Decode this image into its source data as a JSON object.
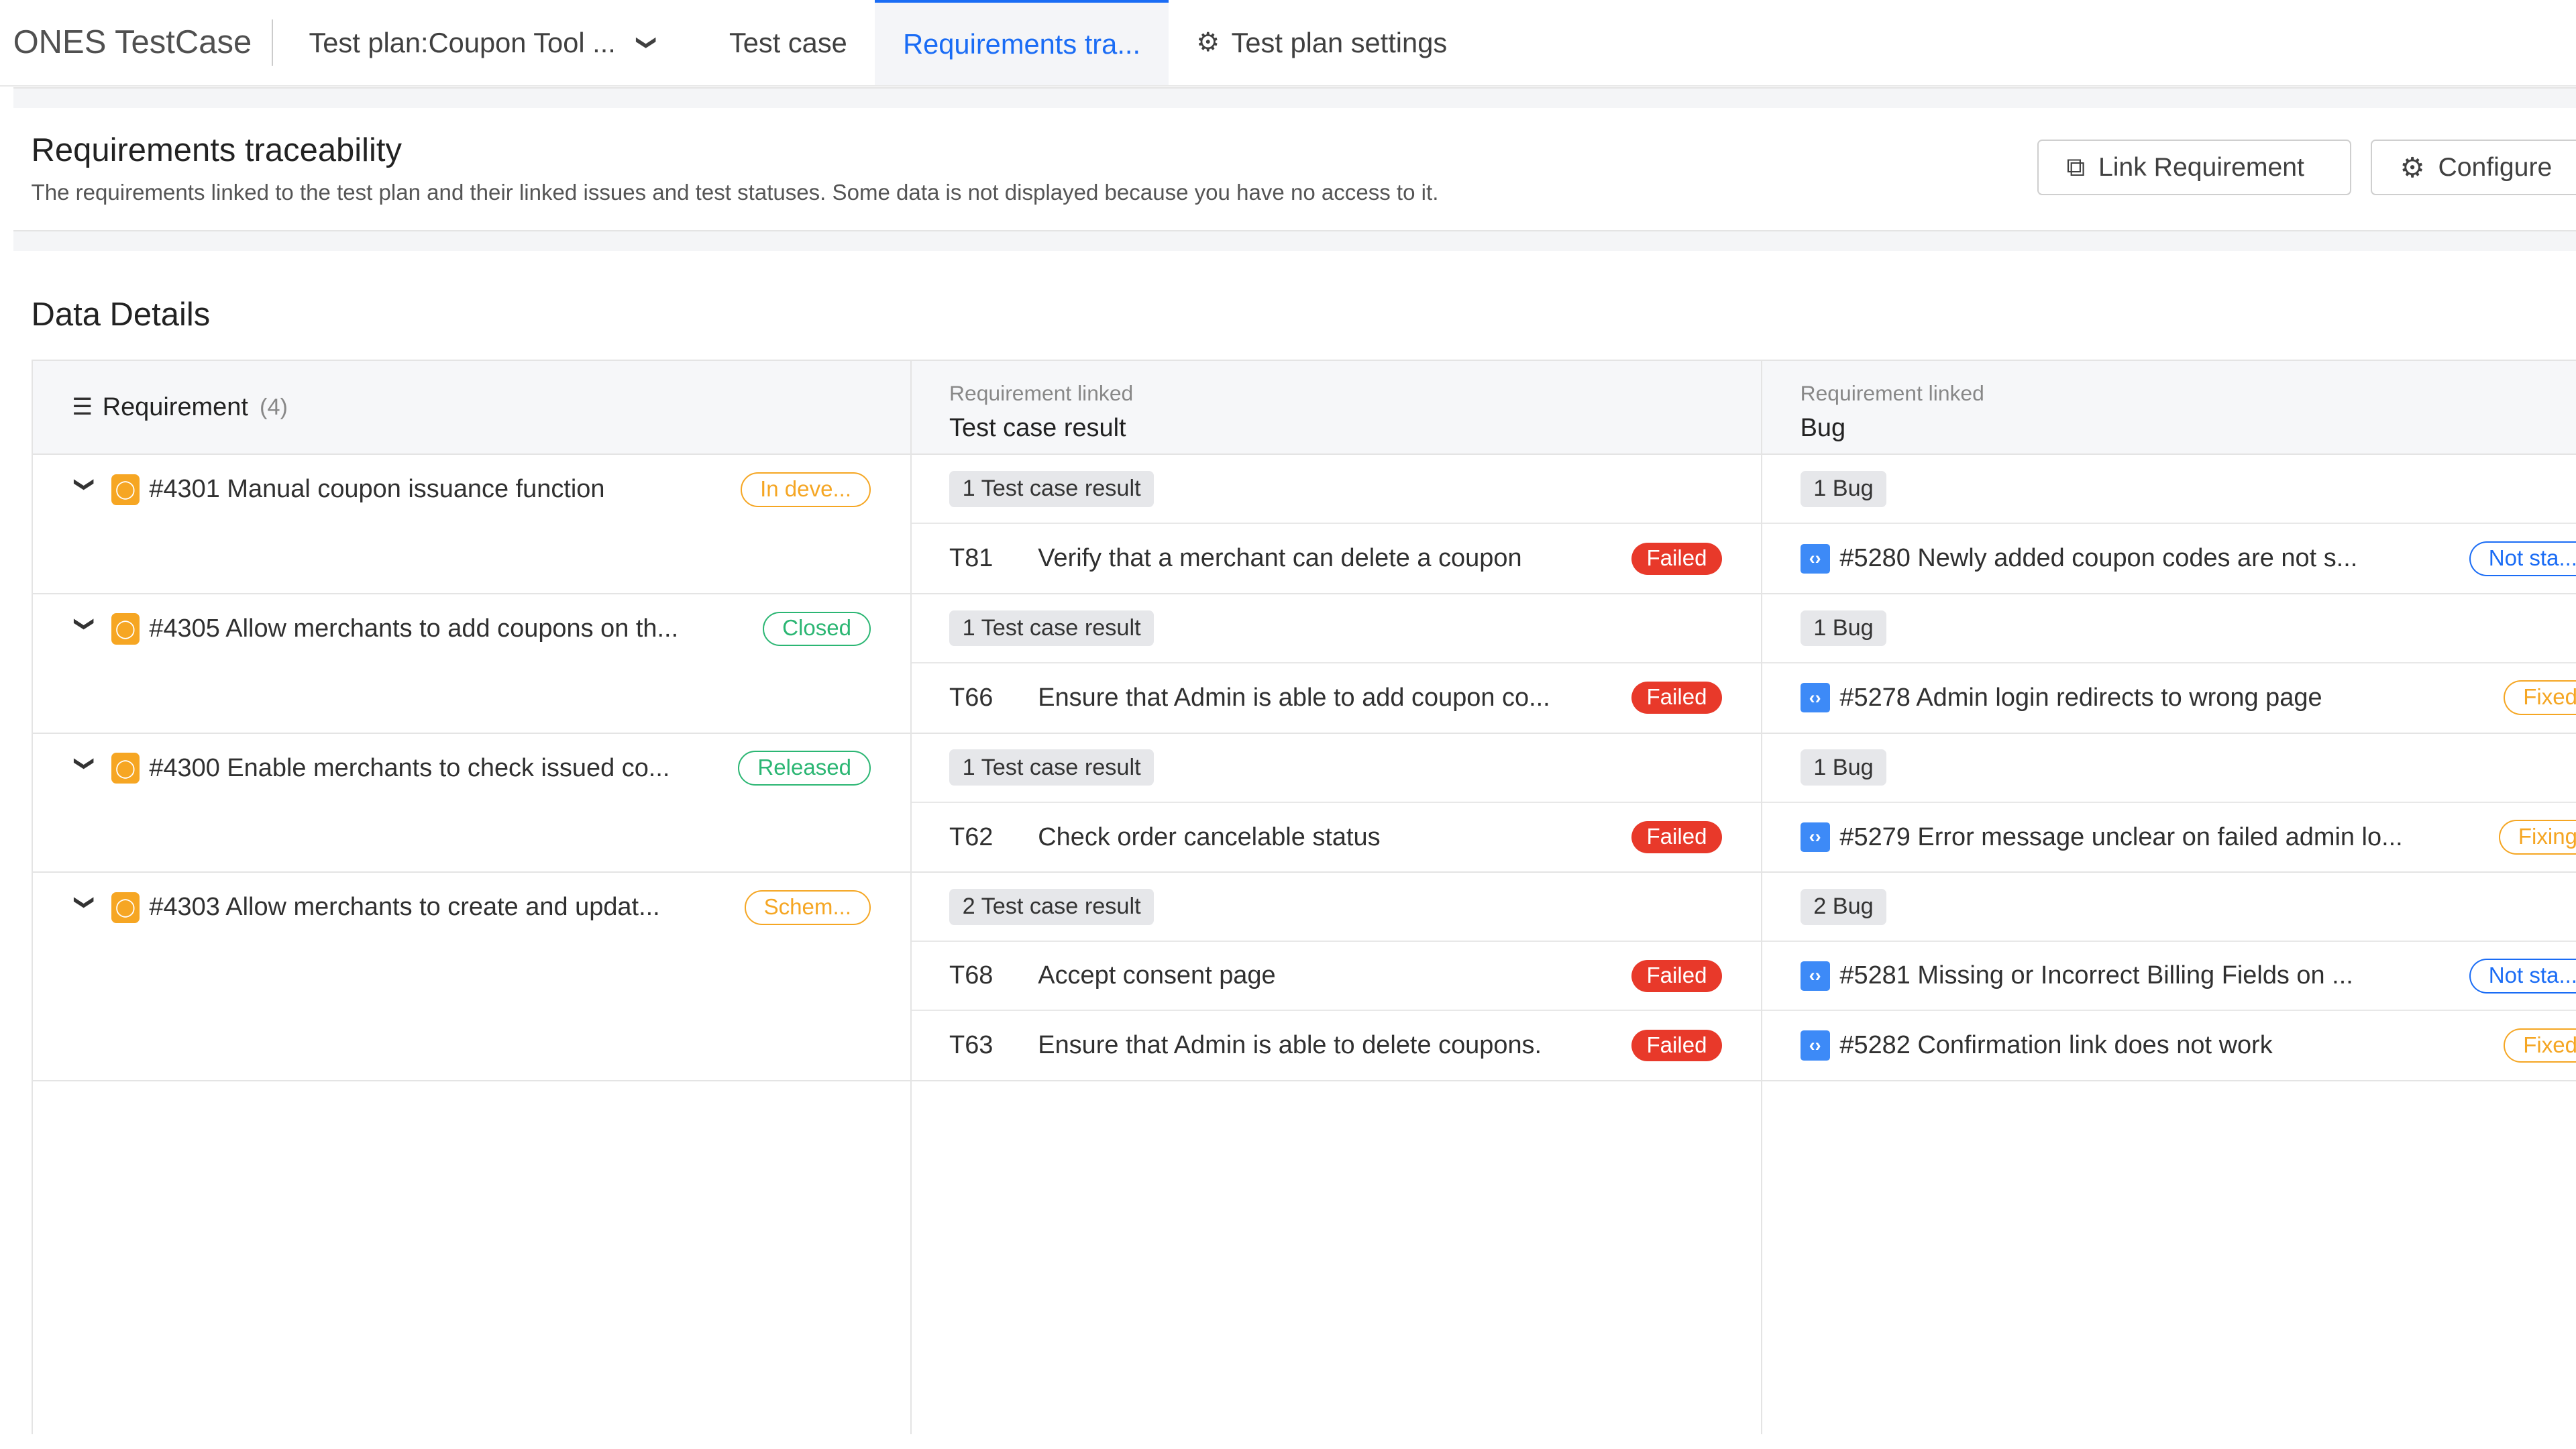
{
  "topbar": {
    "brand": "ONES TestCase",
    "plan": "Test plan:Coupon Tool ...",
    "tabs": [
      {
        "label": "Test case",
        "active": false
      },
      {
        "label": "Requirements tra...",
        "active": true
      },
      {
        "label": "Test plan settings",
        "active": false,
        "icon": "gear-icon"
      }
    ]
  },
  "header": {
    "title": "Requirements traceability",
    "description": "The requirements linked to the test plan and their linked issues and test statuses. Some data is not displayed because you have no access to it.",
    "link_button": "Link Requirement",
    "configure_button": "Configure"
  },
  "section_title": "Data Details",
  "table": {
    "col1": {
      "label": "Requirement",
      "count": "(4)"
    },
    "col2": {
      "sub": "Requirement linked",
      "label": "Test case result"
    },
    "col3": {
      "sub": "Requirement linked",
      "label": "Bug"
    },
    "groups": [
      {
        "title": "#4301 Manual coupon issuance function",
        "status": "In deve...",
        "status_color": "#f5a623",
        "case_count": "1 Test case result",
        "bug_count": "1 Bug",
        "cases": [
          {
            "id": "T81",
            "name": "Verify that a merchant can delete a coupon",
            "result": "Failed"
          }
        ],
        "bugs": [
          {
            "title": "#5280 Newly added coupon codes are not s...",
            "status": "Not sta...",
            "status_color": "#1a6cf5"
          }
        ]
      },
      {
        "title": "#4305 Allow merchants to add coupons on th...",
        "status": "Closed",
        "status_color": "#2bb673",
        "case_count": "1 Test case result",
        "bug_count": "1 Bug",
        "cases": [
          {
            "id": "T66",
            "name": "Ensure that Admin is able to add coupon co...",
            "result": "Failed"
          }
        ],
        "bugs": [
          {
            "title": "#5278 Admin login redirects to wrong page",
            "status": "Fixed",
            "status_color": "#f5a623"
          }
        ]
      },
      {
        "title": "#4300 Enable merchants to check issued co...",
        "status": "Released",
        "status_color": "#2bb673",
        "case_count": "1 Test case result",
        "bug_count": "1 Bug",
        "cases": [
          {
            "id": "T62",
            "name": "Check order cancelable status",
            "result": "Failed"
          }
        ],
        "bugs": [
          {
            "title": "#5279 Error message unclear on failed admin lo...",
            "status": "Fixing",
            "status_color": "#f5a623"
          }
        ]
      },
      {
        "title": "#4303 Allow merchants to create and updat...",
        "status": "Schem...",
        "status_color": "#f5a623",
        "case_count": "2 Test case result",
        "bug_count": "2 Bug",
        "cases": [
          {
            "id": "T68",
            "name": "Accept consent page",
            "result": "Failed"
          },
          {
            "id": "T63",
            "name": "Ensure that Admin is able to delete coupons.",
            "result": "Failed"
          }
        ],
        "bugs": [
          {
            "title": "#5281 Missing or Incorrect Billing Fields on ...",
            "status": "Not sta...",
            "status_color": "#1a6cf5"
          },
          {
            "title": "#5282 Confirmation link does not work",
            "status": "Fixed",
            "status_color": "#f5a623"
          }
        ]
      }
    ]
  }
}
